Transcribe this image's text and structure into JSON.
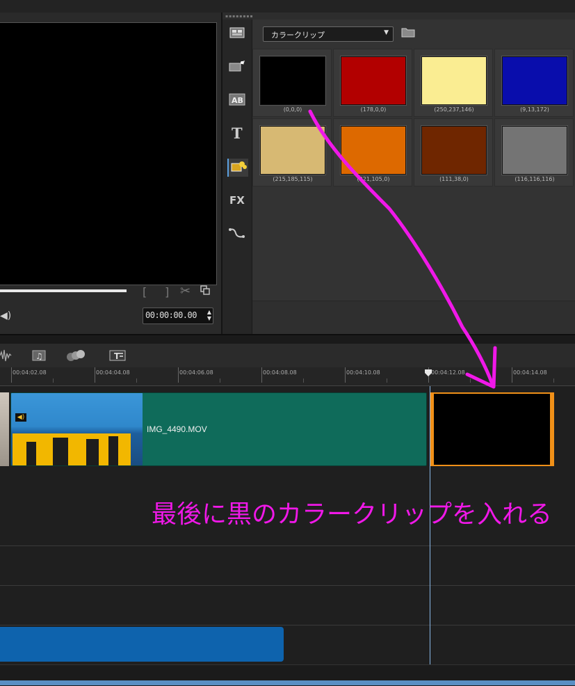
{
  "preview": {
    "timecode": "00:00:00.00",
    "bracket_in": "[",
    "bracket_out": "]"
  },
  "library": {
    "category": "カラークリップ",
    "swatches": [
      {
        "label": "(0,0,0)",
        "color": "#000000"
      },
      {
        "label": "(178,0,0)",
        "color": "#b20000"
      },
      {
        "label": "(250,237,146)",
        "color": "#faed92"
      },
      {
        "label": "(9,13,172)",
        "color": "#090dac"
      },
      {
        "label": "(215,185,115)",
        "color": "#d7b973"
      },
      {
        "label": "(221,105,0)",
        "color": "#dd6900"
      },
      {
        "label": "(111,38,0)",
        "color": "#6f2600"
      },
      {
        "label": "(116,116,116)",
        "color": "#747474"
      }
    ],
    "rail_icons": [
      "media-icon",
      "instant-project-icon",
      "transition-icon",
      "title-icon",
      "graphics-icon",
      "filter-icon",
      "path-icon"
    ]
  },
  "timeline": {
    "ruler_ticks": [
      "00:04:02.08",
      "00:04:04.08",
      "00:04:06.08",
      "00:04:08.08",
      "00:04:10.08",
      "00:04:12.08",
      "00:04:14.08"
    ],
    "video_clip_name": "IMG_4490.MOV",
    "toolbar_icons": [
      "audio-wave-icon",
      "music-icon",
      "motion-icon",
      "subtitle-icon"
    ]
  },
  "annotation": {
    "text": "最後に黒のカラークリップを入れる",
    "color": "#f018e8"
  }
}
